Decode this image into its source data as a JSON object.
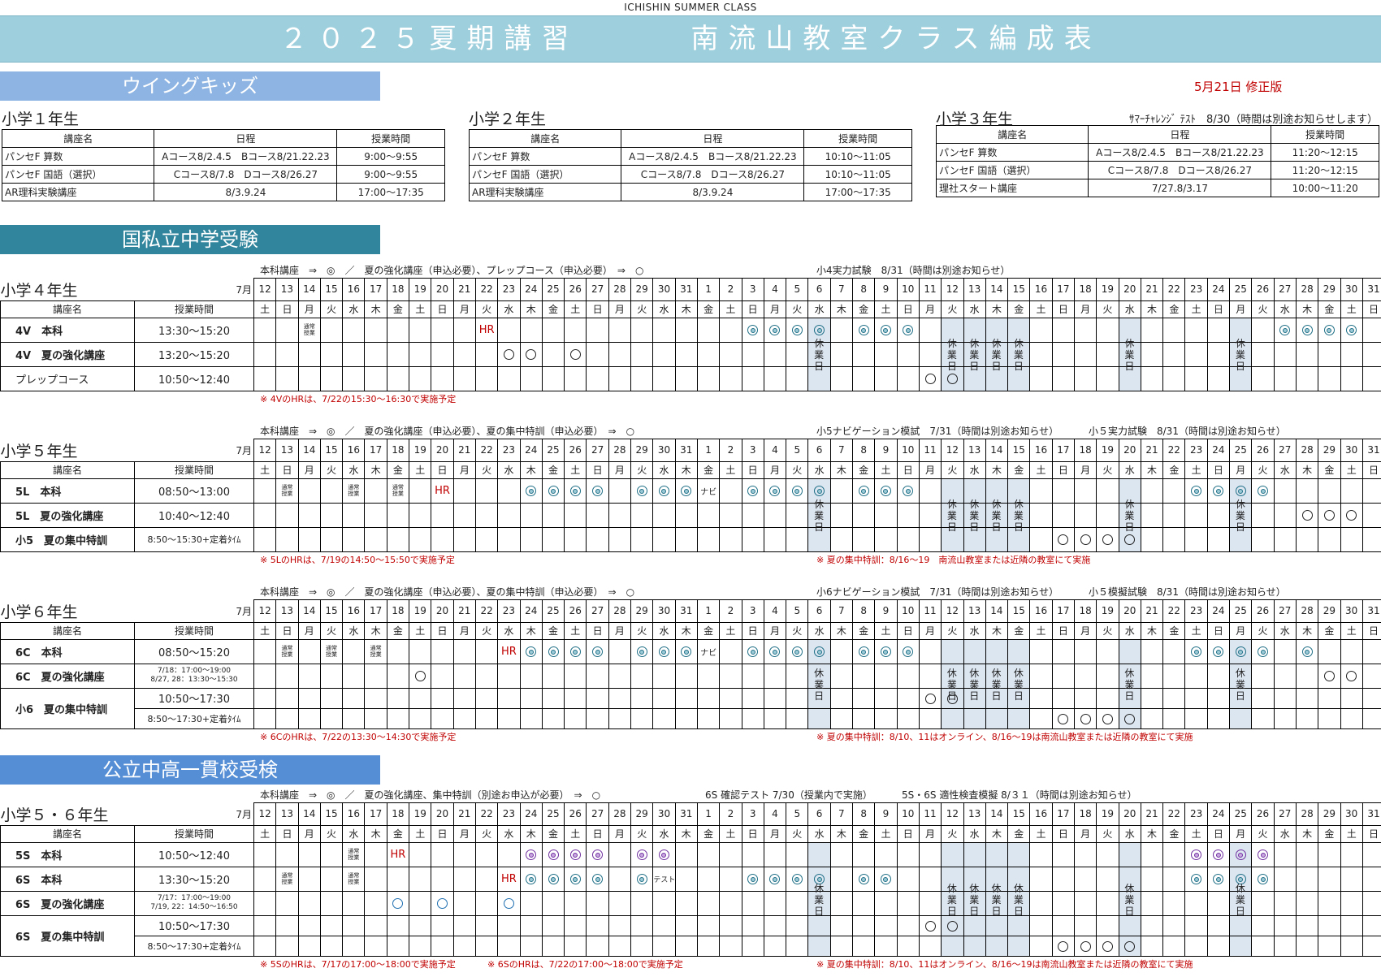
{
  "header": {
    "topline": "ICHISHIN SUMMER CLASS",
    "title": "２０２５夏期講習　　　南流山教室クラス編成表"
  },
  "revision": "5月21日 修正版",
  "sections": {
    "wing": "ウイングキッズ",
    "kokushi": "国私立中学受験",
    "koritsu": "公立中高一貫校受検"
  },
  "wing": {
    "columns": [
      "講座名",
      "日程",
      "授業時間"
    ],
    "g1": {
      "title": "小学１年生",
      "note": "",
      "rows": [
        [
          "パンセF 算数",
          "Aコース8/2.4.5　Bコース8/21.22.23",
          "9:00～9:55"
        ],
        [
          "パンセF 国語（選択）",
          "Cコース8/7.8　Dコース8/26.27",
          "9:00～9:55"
        ],
        [
          "AR理科実験講座",
          "8/3.9.24",
          "17:00～17:35"
        ]
      ]
    },
    "g2": {
      "title": "小学２年生",
      "note": "",
      "rows": [
        [
          "パンセF 算数",
          "Aコース8/2.4.5　Bコース8/21.22.23",
          "10:10～11:05"
        ],
        [
          "パンセF 国語（選択）",
          "Cコース8/7.8　Dコース8/26.27",
          "10:10～11:05"
        ],
        [
          "AR理科実験講座",
          "8/3.9.24",
          "17:00～17:35"
        ]
      ]
    },
    "g3": {
      "title": "小学３年生",
      "note": "ｻﾏｰﾁｬﾚﾝｼﾞ ﾃｽﾄ　8/30（時間は別途お知らせします）",
      "rows": [
        [
          "パンセF 算数",
          "Aコース8/2.4.5　Bコース8/21.22.23",
          "11:20～12:15"
        ],
        [
          "パンセF 国語（選択）",
          "Cコース8/7.8　Dコース8/26.27",
          "11:20～12:15"
        ],
        [
          "理社スタート講座",
          "7/27.8/3.17",
          "10:00～11:20"
        ]
      ]
    }
  },
  "calendar": {
    "month": "7月",
    "dates": [
      "12",
      "13",
      "14",
      "15",
      "16",
      "17",
      "18",
      "19",
      "20",
      "21",
      "22",
      "23",
      "24",
      "25",
      "26",
      "27",
      "28",
      "29",
      "30",
      "31",
      "1",
      "2",
      "3",
      "4",
      "5",
      "6",
      "7",
      "8",
      "9",
      "10",
      "11",
      "12",
      "13",
      "14",
      "15",
      "16",
      "17",
      "18",
      "19",
      "20",
      "21",
      "22",
      "23",
      "24",
      "25",
      "26",
      "27",
      "28",
      "29",
      "30",
      "31"
    ],
    "weekdays": [
      "土",
      "日",
      "月",
      "火",
      "水",
      "木",
      "金",
      "土",
      "日",
      "月",
      "火",
      "水",
      "木",
      "金",
      "土",
      "日",
      "月",
      "火",
      "水",
      "木",
      "金",
      "土",
      "日",
      "月",
      "火",
      "水",
      "木",
      "金",
      "土",
      "日",
      "月",
      "火",
      "水",
      "木",
      "金",
      "土",
      "日",
      "月",
      "火",
      "水",
      "木",
      "金",
      "土",
      "日",
      "月",
      "火",
      "水",
      "木",
      "金",
      "土",
      "日"
    ],
    "col_name": "講座名",
    "col_time": "授業時間",
    "holiday_cols": [
      25,
      31,
      32,
      33,
      34,
      39,
      44
    ],
    "holiday_text": "休業日",
    "tsujo": "通常授業",
    "hr": "HR",
    "navi": "ナビ",
    "test": "テスト"
  },
  "g4": {
    "legend": "本科講座　⇒　◎　／　夏の強化講座（申込必要）、プレップコース（申込必要）　⇒　○",
    "exam1": "小4実力試験　8/31（時間は別途お知らせ）",
    "exam2": "",
    "title": "小学４年生",
    "rows": [
      {
        "name": "4V　本科",
        "time": "13:30～15:20",
        "cells": {
          "2": "T",
          "10": "HR",
          "22": "D",
          "23": "D",
          "24": "D",
          "25": "D",
          "27": "D",
          "28": "D",
          "29": "D",
          "46": "D",
          "47": "D",
          "48": "D",
          "49": "D",
          "51": "TEST"
        }
      },
      {
        "name": "4V　夏の強化講座",
        "time": "13:20～15:20",
        "cells": {
          "11": "O",
          "12": "O",
          "14": "O"
        }
      },
      {
        "name": "プレップコース",
        "time": "10:50～12:40",
        "cells": {
          "30": "O",
          "31": "O"
        }
      }
    ],
    "note1": "※ 4VのHRは、7/22の15:30～16:30で実施予定",
    "note2": ""
  },
  "g5": {
    "legend": "本科講座　⇒　◎　／　夏の強化講座（申込必要）、夏の集中特訓（申込必要）　⇒　○",
    "exam1": "小5ナビゲーション模試　7/31（時間は別途お知らせ）",
    "exam2": "小５実力試験　8/31（時間は別途お知らせ）",
    "title": "小学５年生",
    "rows": [
      {
        "name": "5L　本科",
        "time": "08:50～13:00",
        "cells": {
          "1": "T",
          "4": "T",
          "6": "T",
          "8": "HR",
          "12": "D",
          "13": "D",
          "14": "D",
          "15": "D",
          "17": "D",
          "18": "D",
          "19": "D",
          "20": "NAVI",
          "22": "D",
          "23": "D",
          "24": "D",
          "25": "D",
          "27": "D",
          "28": "D",
          "29": "D",
          "42": "D",
          "43": "D",
          "44": "D",
          "45": "D",
          "51": "TEST"
        }
      },
      {
        "name": "5L　夏の強化講座",
        "time": "10:40～12:40",
        "cells": {
          "47": "O",
          "48": "O",
          "49": "O"
        }
      },
      {
        "name": "小5　夏の集中特訓",
        "time": "8:50～15:30+定着ﾀｲﾑ",
        "cells": {
          "36": "O",
          "37": "O",
          "38": "O",
          "39": "O"
        }
      }
    ],
    "note1": "※ 5LのHRは、7/19の14:50～15:50で実施予定",
    "note2": "※ 夏の集中特訓：8/16～19　南流山教室または近隣の教室にて実施"
  },
  "g6": {
    "legend": "本科講座　⇒　◎　／　夏の強化講座（申込必要）、夏の集中特訓（申込必要）　⇒　○",
    "exam1": "小6ナビゲーション模試　7/31（時間は別途お知らせ）",
    "exam2": "小５模擬試験　8/31（時間は別途お知らせ）",
    "title": "小学６年生",
    "rows": [
      {
        "name": "6C　本科",
        "time": "08:50～15:20",
        "cells": {
          "1": "T",
          "3": "T",
          "5": "T",
          "11": "HR",
          "12": "D",
          "13": "D",
          "14": "D",
          "15": "D",
          "17": "D",
          "18": "D",
          "19": "D",
          "20": "NAVI",
          "22": "D",
          "23": "D",
          "24": "D",
          "25": "D",
          "27": "D",
          "28": "D",
          "29": "D",
          "42": "D",
          "43": "D",
          "44": "D",
          "45": "D",
          "47": "D",
          "51": "TEST"
        }
      },
      {
        "name": "6C　夏の強化講座",
        "time": "7/18：17:00～19:00",
        "time2": "8/27, 28：13:30～15:30",
        "cells": {
          "7": "O",
          "48": "O",
          "49": "O"
        }
      },
      {
        "name": "小6　夏の集中特訓",
        "time": "10:50～17:30",
        "cells": {
          "30": "O",
          "31": "O"
        }
      },
      {
        "name": "",
        "time": "8:50～17:30+定着ﾀｲﾑ",
        "cells": {
          "36": "O",
          "37": "O",
          "38": "O",
          "39": "O"
        }
      }
    ],
    "note1": "※ 6CのHRは、7/22の13:30～14:30で実施予定",
    "note2": "※ 夏の集中特訓：8/10、11はオンライン、8/16～19は南流山教室または近隣の教室にて実施"
  },
  "g56": {
    "legend": "本科講座　⇒　◎　／　夏の強化講座、集中特訓（別途お申込が必要）　⇒　○",
    "exam1": "6S 確認テスト 7/30（授業内で実施）",
    "exam2": "5S・6S 適性検査模擬 8/３１（時間は別途お知らせ）",
    "title": "小学５・６年生",
    "rows": [
      {
        "name": "5S　本科",
        "time": "10:50～12:40",
        "cells": {
          "4": "T",
          "6": "HR",
          "12": "P",
          "13": "P",
          "14": "P",
          "15": "P",
          "17": "P",
          "18": "P",
          "42": "P",
          "43": "P",
          "44": "P",
          "45": "P",
          "51": "TEST"
        }
      },
      {
        "name": "6S　本科",
        "time": "13:30～15:20",
        "cells": {
          "1": "T",
          "4": "T",
          "11": "HR",
          "12": "D",
          "13": "D",
          "14": "D",
          "15": "D",
          "17": "D",
          "18": "TEST",
          "22": "D",
          "23": "D",
          "24": "D",
          "25": "D",
          "27": "D",
          "28": "D",
          "42": "D",
          "43": "D",
          "44": "D",
          "45": "D",
          "51": "TEST"
        }
      },
      {
        "name": "6S　夏の強化講座",
        "time": "7/17：17:00～19:00",
        "time2": "7/19, 22：14:50～16:50",
        "cells": {
          "6": "B",
          "8": "B",
          "11": "B"
        }
      },
      {
        "name": "6S　夏の集中特訓",
        "time": "10:50～17:30",
        "cells": {
          "30": "O",
          "31": "O"
        }
      },
      {
        "name": "",
        "time": "8:50～17:30+定着ﾀｲﾑ",
        "cells": {
          "36": "O",
          "37": "O",
          "38": "O",
          "39": "O"
        }
      }
    ],
    "note1": "※ 5SのHRは、7/17の17:00～18:00で実施予定",
    "note1b": "※ 6SのHRは、7/22の17:00～18:00で実施予定",
    "note2": "※ 夏の集中特訓：8/10、11はオンライン、8/16～19は南流山教室または近隣の教室にて実施"
  }
}
